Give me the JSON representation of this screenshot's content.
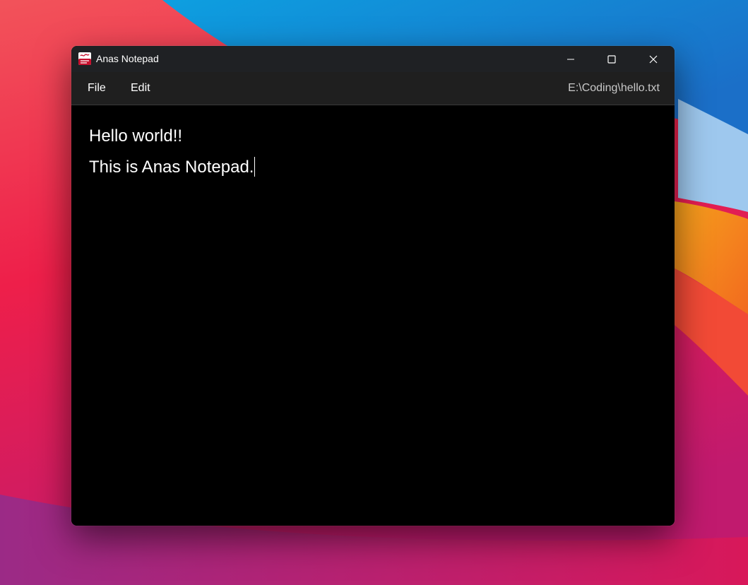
{
  "window": {
    "title": "Anas Notepad",
    "file_path": "E:\\Coding\\hello.txt"
  },
  "window_controls": {
    "minimize": "minimize-icon",
    "maximize": "maximize-icon",
    "close": "close-icon"
  },
  "menu": {
    "items": [
      {
        "label": "File"
      },
      {
        "label": "Edit"
      }
    ]
  },
  "editor": {
    "lines": [
      "Hello world!!",
      "This is Anas Notepad."
    ]
  },
  "colors": {
    "titlebar": "#1f2124",
    "menubar": "#1f1f1f",
    "editor_background": "#000000",
    "text": "#ffffff",
    "path_text": "#c8c8c8"
  }
}
